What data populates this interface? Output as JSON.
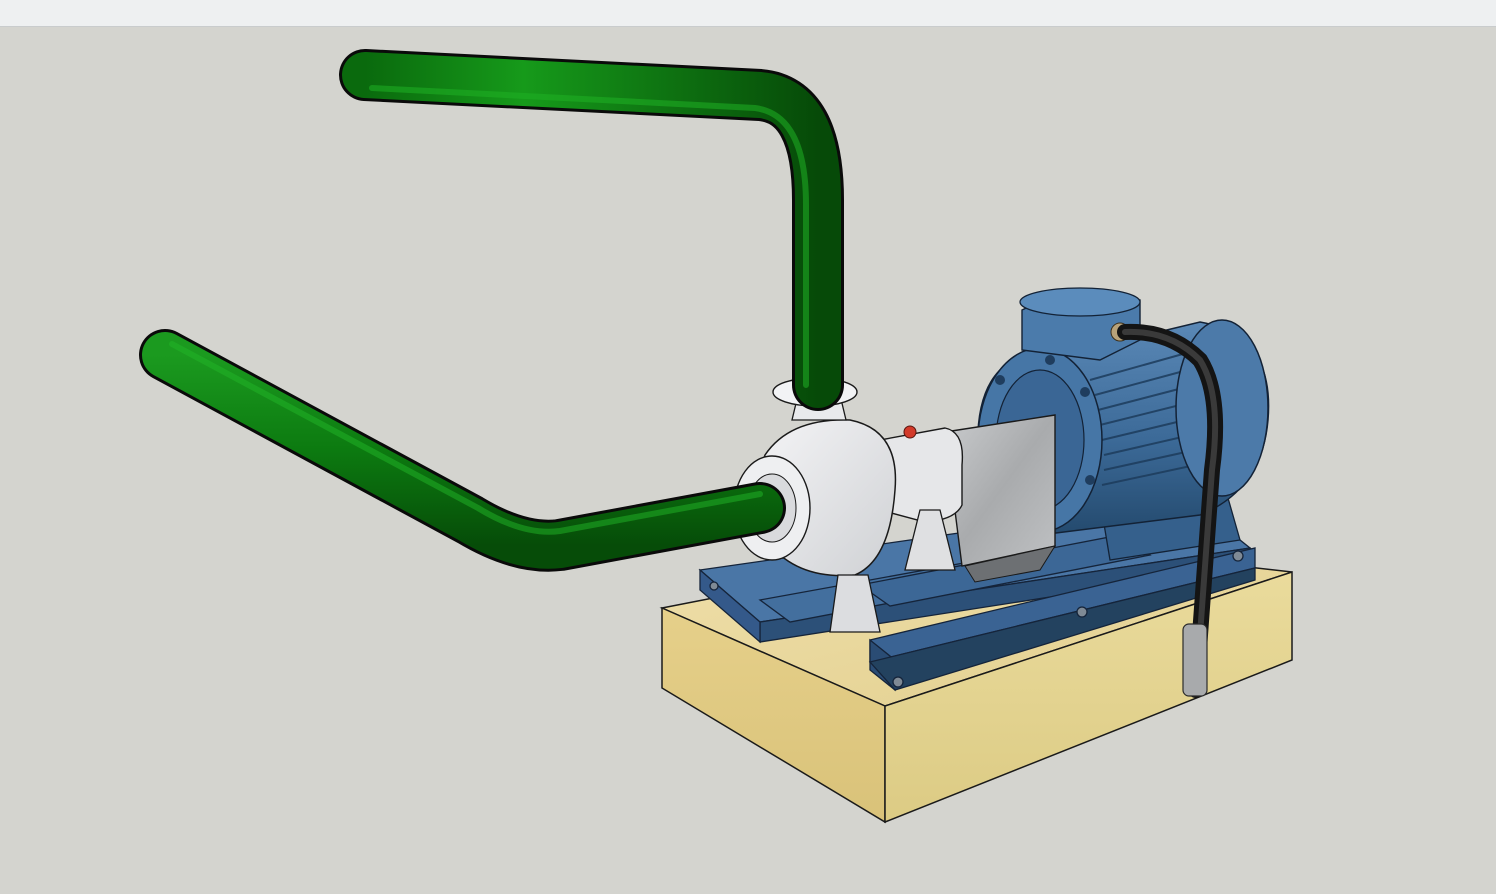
{
  "window": {
    "title": ""
  },
  "scene": {
    "description_visible_text": "",
    "colors": {
      "background": "#d4d4cf",
      "pipe": "#0e7a12",
      "pipe_dark": "#064a09",
      "pump_casing": "#e9eaec",
      "motor": "#3f6f9e",
      "motor_dark": "#274c70",
      "frame": "#3e6797",
      "base_wood": "#e8d8a0",
      "cable": "#2b2b2b",
      "indicator": "#d23a2a"
    },
    "objects": [
      "suction-pipe",
      "discharge-pipe",
      "pump-casing",
      "bearing-housing",
      "coupling-guard",
      "electric-motor",
      "terminal-box",
      "power-cable",
      "steel-base-frame",
      "concrete-wooden-plinth"
    ]
  }
}
